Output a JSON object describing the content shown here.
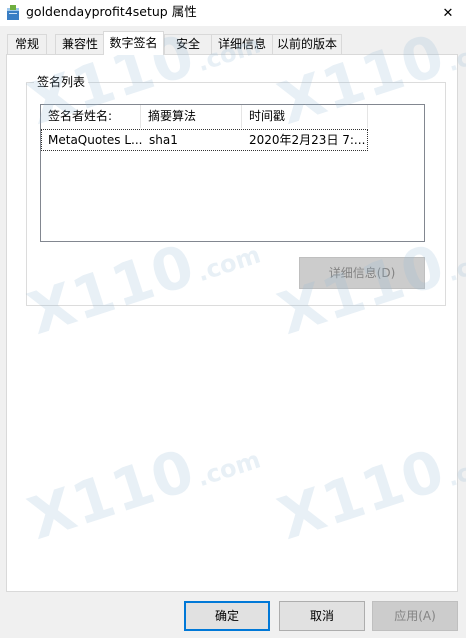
{
  "window": {
    "title": "goldendayprofit4setup 属性",
    "close_glyph": "✕"
  },
  "tabs": [
    {
      "label": "常规"
    },
    {
      "label": "兼容性"
    },
    {
      "label": "数字签名",
      "active": true
    },
    {
      "label": "安全"
    },
    {
      "label": "详细信息"
    },
    {
      "label": "以前的版本"
    }
  ],
  "signature_list": {
    "legend": "签名列表",
    "columns": [
      "签名者姓名:",
      "摘要算法",
      "时间戳"
    ],
    "rows": [
      {
        "name": "MetaQuotes L...",
        "algorithm": "sha1",
        "timestamp": "2020年2月23日 7:..."
      }
    ],
    "details_button": "详细信息(D)"
  },
  "footer": {
    "ok": "确定",
    "cancel": "取消",
    "apply": "应用(A)"
  },
  "watermark": {
    "main": "X110",
    "suffix": ".com"
  },
  "colors": {
    "accent": "#0078d7",
    "disabled_bg": "#cccccc",
    "disabled_text": "#838383"
  },
  "icons": {
    "app": "installer-box-icon",
    "close": "close-icon"
  }
}
